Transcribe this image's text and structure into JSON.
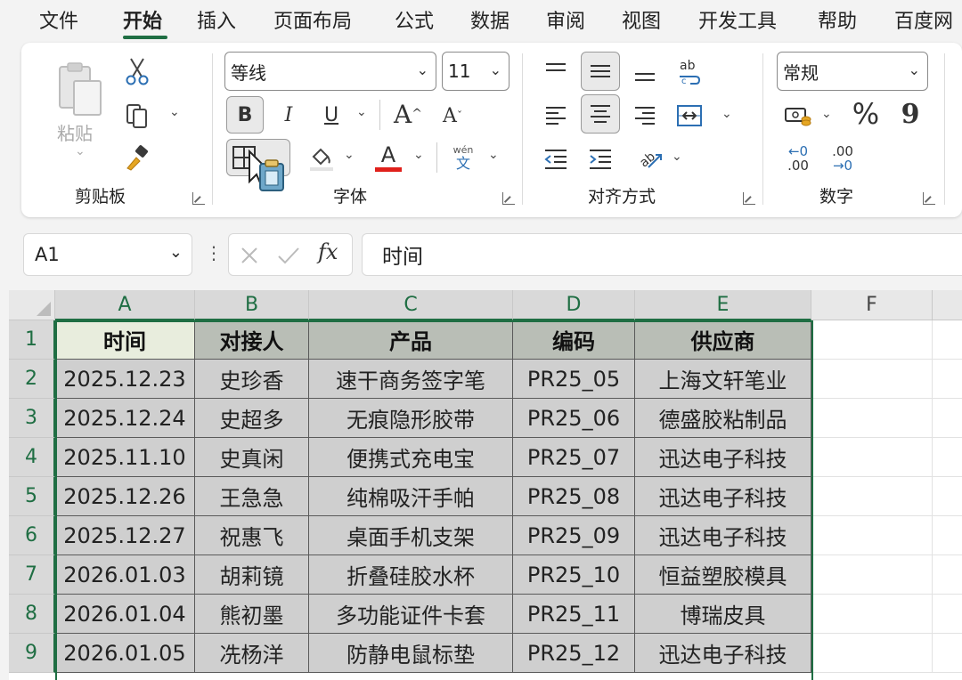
{
  "menu": {
    "tabs": [
      "文件",
      "开始",
      "插入",
      "页面布局",
      "公式",
      "数据",
      "审阅",
      "视图",
      "开发工具",
      "帮助",
      "百度网"
    ],
    "active_index": 1
  },
  "ribbon": {
    "clipboard": {
      "label": "剪贴板",
      "paste_label": "粘贴"
    },
    "font": {
      "label": "字体",
      "font_name": "等线",
      "font_size": "11",
      "bold": "B",
      "italic": "I",
      "underline": "U",
      "grow": "A",
      "shrink": "A",
      "color_letter": "A",
      "pinyin_top": "wén",
      "pinyin_bottom": "文"
    },
    "alignment": {
      "label": "对齐方式"
    },
    "number": {
      "label": "数字",
      "format": "常规",
      "percent": "%",
      "comma": "9",
      "inc_top": "←0",
      "inc_bottom": ".00",
      "dec_top": ".00",
      "dec_bottom": "→0"
    }
  },
  "formula_bar": {
    "name_box": "A1",
    "fx": "fx",
    "content": "时间"
  },
  "accent": "#1f6e43",
  "sheet": {
    "columns": [
      "A",
      "B",
      "C",
      "D",
      "E",
      "F"
    ],
    "rows": [
      "1",
      "2",
      "3",
      "4",
      "5",
      "6",
      "7",
      "8",
      "9"
    ],
    "header": [
      "时间",
      "对接人",
      "产品",
      "编码",
      "供应商"
    ],
    "data": [
      [
        "2025.12.23",
        "史珍香",
        "速干商务签字笔",
        "PR25_05",
        "上海文轩笔业"
      ],
      [
        "2025.12.24",
        "史超多",
        "无痕隐形胶带",
        "PR25_06",
        "德盛胶粘制品"
      ],
      [
        "2025.11.10",
        "史真闲",
        "便携式充电宝",
        "PR25_07",
        "迅达电子科技"
      ],
      [
        "2025.12.26",
        "王急急",
        "纯棉吸汗手帕",
        "PR25_08",
        "迅达电子科技"
      ],
      [
        "2025.12.27",
        "祝惠飞",
        "桌面手机支架",
        "PR25_09",
        "迅达电子科技"
      ],
      [
        "2026.01.03",
        "胡莉镜",
        "折叠硅胶水杯",
        "PR25_10",
        "恒益塑胶模具"
      ],
      [
        "2026.01.04",
        "熊初墨",
        "多功能证件卡套",
        "PR25_11",
        "博瑞皮具"
      ],
      [
        "2026.01.05",
        "冼杨洋",
        "防静电鼠标垫",
        "PR25_12",
        "迅达电子科技"
      ]
    ]
  }
}
